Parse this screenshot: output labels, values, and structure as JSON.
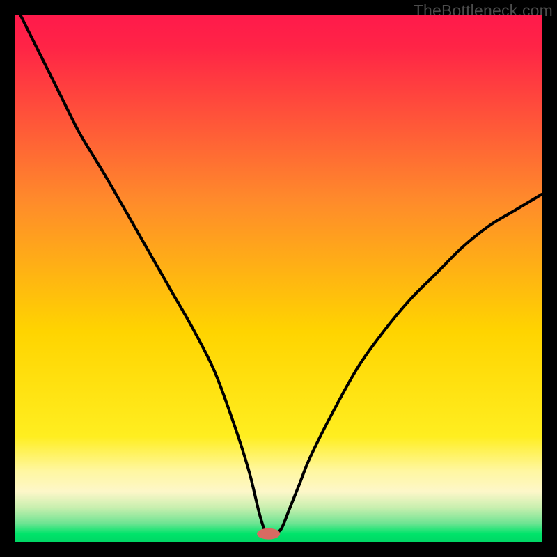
{
  "watermark": "TheBottleneck.com",
  "colors": {
    "frame": "#000000",
    "gradient_top": "#ff1a4b",
    "gradient_mid1": "#ff8a2b",
    "gradient_mid2": "#ffe100",
    "gradient_band": "#fff7a0",
    "gradient_green": "#00e46a",
    "curve": "#000000",
    "marker": "#d86a62"
  },
  "chart_data": {
    "type": "line",
    "title": "",
    "xlabel": "",
    "ylabel": "",
    "xlim": [
      0,
      100
    ],
    "ylim": [
      0,
      100
    ],
    "annotations": [],
    "series": [
      {
        "name": "bottleneck-curve",
        "x": [
          0,
          2,
          5,
          8,
          12,
          15,
          18,
          22,
          26,
          30,
          34,
          38,
          42,
          44.5,
          46.2,
          47.2,
          47.8,
          48.4,
          49.2,
          50.5,
          52,
          54,
          56,
          60,
          65,
          70,
          75,
          80,
          85,
          90,
          95,
          100
        ],
        "y": [
          102,
          98,
          92,
          86,
          78,
          73,
          68,
          61,
          54,
          47,
          40,
          32,
          21,
          13,
          6,
          2.6,
          1.6,
          1.6,
          1.7,
          2.4,
          6,
          11,
          16,
          24,
          33,
          40,
          46,
          51,
          56,
          60,
          63,
          66
        ]
      }
    ],
    "marker": {
      "name": "optimal-point",
      "x": 48.1,
      "y": 1.5,
      "rx": 2.2,
      "ry": 1.05
    },
    "background_gradient_stops": [
      {
        "offset": 0.0,
        "color": "#ff1a4b"
      },
      {
        "offset": 0.06,
        "color": "#ff2446"
      },
      {
        "offset": 0.35,
        "color": "#ff8a2b"
      },
      {
        "offset": 0.6,
        "color": "#ffd400"
      },
      {
        "offset": 0.8,
        "color": "#ffee20"
      },
      {
        "offset": 0.865,
        "color": "#fff7a0"
      },
      {
        "offset": 0.905,
        "color": "#fdf7c9"
      },
      {
        "offset": 0.935,
        "color": "#c9efaf"
      },
      {
        "offset": 0.965,
        "color": "#6fe493"
      },
      {
        "offset": 0.985,
        "color": "#00e46a"
      },
      {
        "offset": 1.0,
        "color": "#00d765"
      }
    ]
  }
}
